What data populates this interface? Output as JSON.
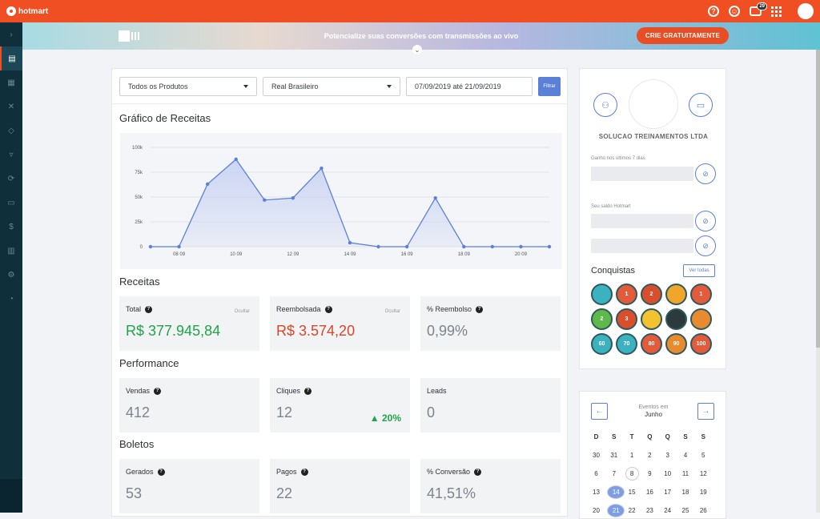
{
  "topbar": {
    "brand": "hotmart",
    "notif_count": "29",
    "help_icon": "question-icon",
    "colors": {
      "brand": "#f04e23"
    }
  },
  "banner": {
    "text": "Potencialize suas conversões com transmissões ao vivo",
    "cta": "CRIE GRATUITAMENTE"
  },
  "filters": {
    "product": "Todos os Produtos",
    "currency": "Real Brasileiro",
    "date_range": "07/09/2019 até 21/09/2019",
    "button": "Filtrar"
  },
  "sections": {
    "chart_title": "Gráfico de Receitas",
    "revenue": "Receitas",
    "performance": "Performance",
    "boletos": "Boletos"
  },
  "chart_data": {
    "type": "area",
    "title": "Gráfico de Receitas",
    "x": [
      "07 09",
      "08 09",
      "09 09",
      "10 09",
      "11 09",
      "12 09",
      "13 09",
      "14 09",
      "15 09",
      "16 09",
      "17 09",
      "18 09",
      "19 09",
      "20 09",
      "21 09"
    ],
    "xtick_labels": [
      "08 09",
      "10 09",
      "12 09",
      "14 09",
      "16 09",
      "18 09",
      "20 09"
    ],
    "values": [
      0,
      0,
      63000,
      88000,
      47000,
      49000,
      79000,
      4000,
      0,
      0,
      49000,
      0,
      0,
      0,
      0
    ],
    "ytick_labels": [
      "100k",
      "75k",
      "50k",
      "25k",
      "0"
    ],
    "ylim": [
      0,
      100000
    ],
    "grid": true,
    "colors": {
      "line": "#5b80d8",
      "fill": "#c9d3f3"
    }
  },
  "revenue": {
    "total": {
      "label": "Total",
      "hide": "Ocultar",
      "value": "R$ 377.945,84"
    },
    "refunded": {
      "label": "Reembolsada",
      "hide": "Ocultar",
      "value": "R$ 3.574,20"
    },
    "refund_pct": {
      "label": "% Reembolso",
      "value": "0,99%"
    }
  },
  "performance": {
    "sales": {
      "label": "Vendas",
      "value": "412"
    },
    "clicks": {
      "label": "Cliques",
      "value": "12",
      "trend": "▲ 20%"
    },
    "leads": {
      "label": "Leads",
      "value": "0"
    }
  },
  "boletos": {
    "generated": {
      "label": "Gerados",
      "value": "53"
    },
    "paid": {
      "label": "Pagos",
      "value": "22"
    },
    "conversion": {
      "label": "% Conversão",
      "value": "41,51%"
    }
  },
  "profile": {
    "company": "SOLUCAO TREINAMENTOS LTDA",
    "earned_label": "Ganho nos últimos 7 dias",
    "balance_label": "Seu saldo Hotmart",
    "achievements_title": "Conquistas",
    "see_all": "Ver todas",
    "medals": [
      "",
      "1",
      "2",
      "",
      "1",
      "2",
      "3",
      "",
      "",
      "",
      "60",
      "70",
      "80",
      "90",
      "100"
    ]
  },
  "calendar": {
    "caption": "Eventos em",
    "month": "Junho",
    "weekdays": [
      "D",
      "S",
      "T",
      "Q",
      "Q",
      "S",
      "S"
    ],
    "days": [
      "30",
      "31",
      "1",
      "2",
      "3",
      "4",
      "5",
      "6",
      "7",
      "8",
      "9",
      "10",
      "11",
      "12",
      "13",
      "14",
      "15",
      "16",
      "17",
      "18",
      "19",
      "20",
      "21",
      "22",
      "23",
      "24",
      "25",
      "26"
    ]
  }
}
